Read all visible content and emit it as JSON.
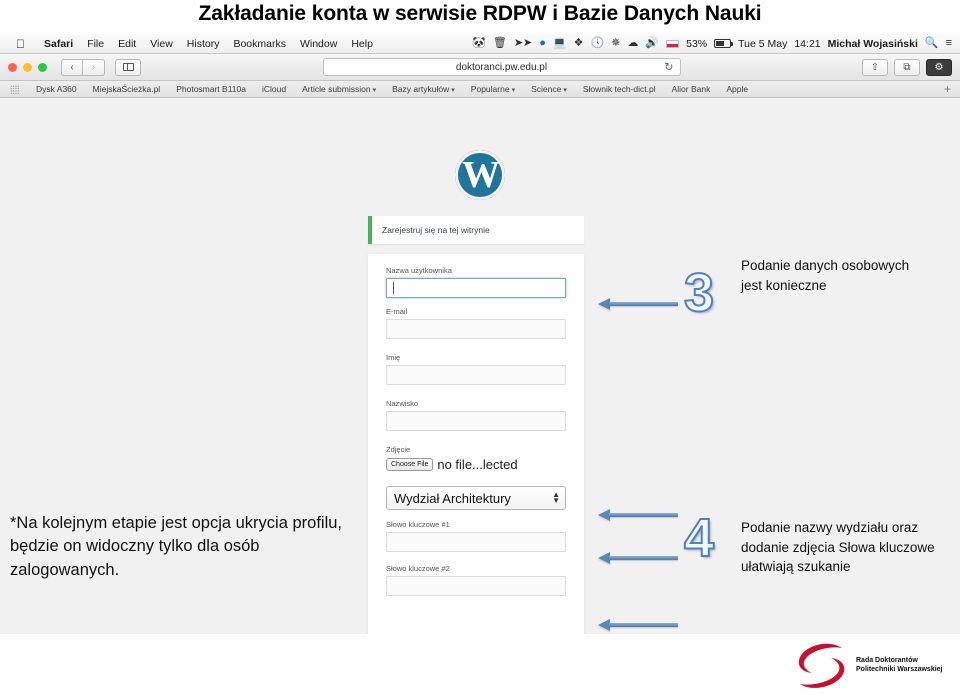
{
  "slide": {
    "title": "Zakładanie konta w serwisie RDPW i Bazie Danych Nauki"
  },
  "menubar": {
    "apple_icon": "apple-icon",
    "items": [
      {
        "label": "Safari",
        "bold": true
      },
      {
        "label": "File",
        "bold": false
      },
      {
        "label": "Edit",
        "bold": false
      },
      {
        "label": "View",
        "bold": false
      },
      {
        "label": "History",
        "bold": false
      },
      {
        "label": "Bookmarks",
        "bold": false
      },
      {
        "label": "Window",
        "bold": false
      },
      {
        "label": "Help",
        "bold": false
      }
    ],
    "status_icons": [
      "evernote-icon",
      "shredder-icon",
      "fast-forward-icon",
      "blue-circle-icon",
      "airplay-icon",
      "dropbox-icon",
      "clock-icon",
      "bluetooth-icon",
      "wifi-icon",
      "volume-icon"
    ],
    "flag": "polish-flag-icon",
    "battery_percent": "53%",
    "date": "Tue 5 May",
    "time": "14:21",
    "user": "Michał Wojasiński",
    "search_icon": "search-icon",
    "notification_icon": "notification-center-icon"
  },
  "toolbar": {
    "back_glyph": "‹",
    "forward_glyph": "›",
    "url": "doktoranci.pw.edu.pl",
    "reload_glyph": "↻",
    "share_glyph": "⇧",
    "tabs_glyph": "⧉",
    "settings_glyph": "⚙"
  },
  "bookmarks": {
    "items": [
      {
        "label": "Dysk A360",
        "dropdown": false
      },
      {
        "label": "MiejskaŚcieżka.pl",
        "dropdown": false
      },
      {
        "label": "Photosmart B110a",
        "dropdown": false
      },
      {
        "label": "iCloud",
        "dropdown": false
      },
      {
        "label": "Article submission",
        "dropdown": true
      },
      {
        "label": "Bazy artykułów",
        "dropdown": true
      },
      {
        "label": "Popularne",
        "dropdown": true
      },
      {
        "label": "Science",
        "dropdown": true
      },
      {
        "label": "Słownik tech-dict.pl",
        "dropdown": false
      },
      {
        "label": "Alior Bank",
        "dropdown": false
      },
      {
        "label": "Apple",
        "dropdown": false
      }
    ],
    "add_glyph": "+"
  },
  "page": {
    "logo_letter": "W",
    "notice": "Zarejestruj się na tej witrynie",
    "fields": [
      {
        "label": "Nazwa użytkownika",
        "value": "",
        "focused": true
      },
      {
        "label": "E-mail",
        "value": "",
        "focused": false
      },
      {
        "label": "Imię",
        "value": "",
        "focused": false
      },
      {
        "label": "Nazwisko",
        "value": "",
        "focused": false
      }
    ],
    "photo_label": "Zdjęcie",
    "choose_file_label": "Choose File",
    "file_status": "no file...lected",
    "faculty_selected": "Wydział Architektury",
    "keyword_fields": [
      {
        "label": "Słowo kluczowe #1",
        "value": ""
      },
      {
        "label": "Słowo kluczowe #2",
        "value": ""
      }
    ]
  },
  "annotations": {
    "step3_number": "3",
    "step3_text": "Podanie danych osobowych jest konieczne",
    "step4_number": "4",
    "step4_text": "Podanie nazwy wydziału oraz dodanie zdjęcia Słowa kluczowe ułatwiają szukanie",
    "left_note": "*Na kolejnym etapie jest opcja ukrycia profilu, będzie on widoczny tylko dla osób zalogowanych."
  },
  "footer": {
    "org_line1": "Rada Doktorantów",
    "org_line2": "Politechniki Warszawskiej",
    "accent_color": "#c8102e"
  },
  "colors": {
    "wp_blue": "#21759b",
    "notice_green": "#46b450",
    "arrow_blue": "#4f81bd",
    "page_bg": "#f1f1f1"
  }
}
